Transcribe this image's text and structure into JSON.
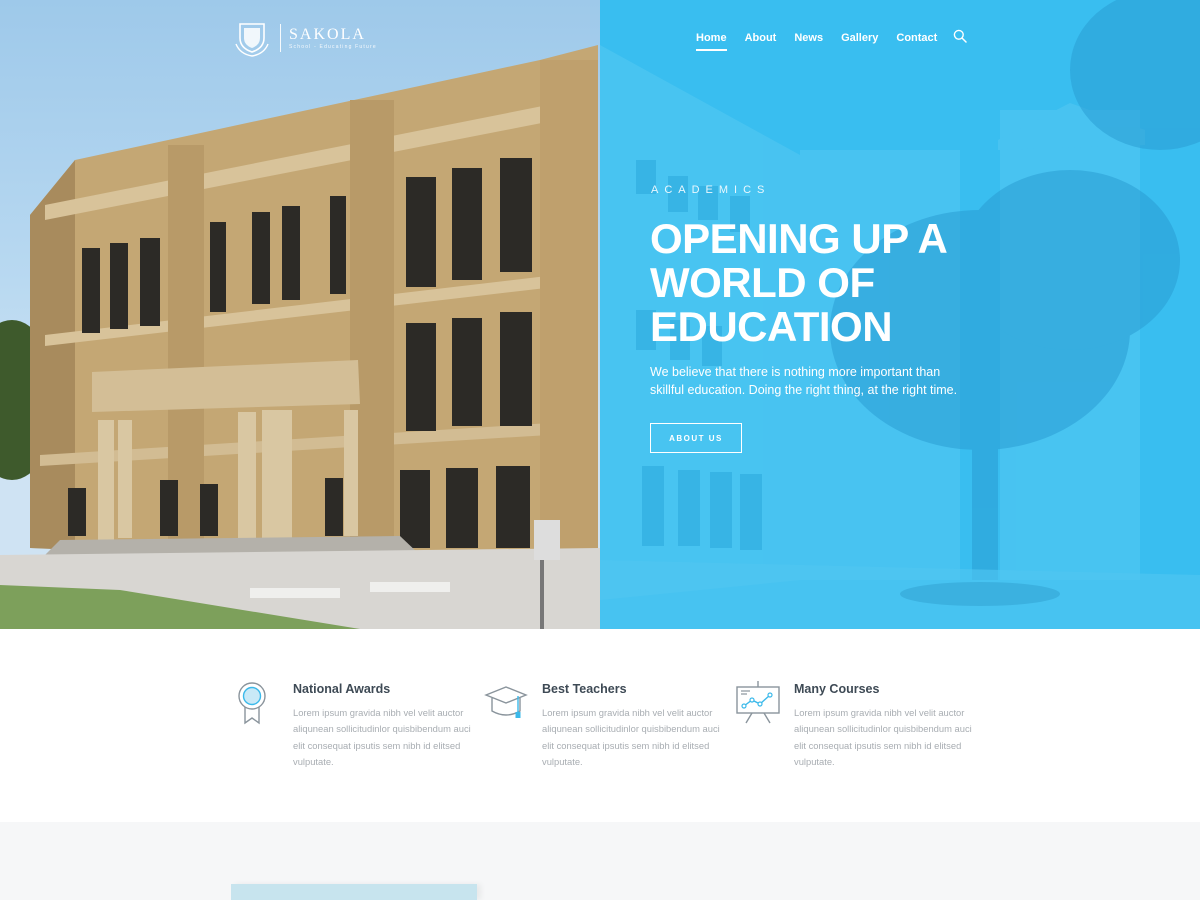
{
  "brand": {
    "name": "SAKOLA",
    "tagline": "School - Educating Future"
  },
  "nav": {
    "items": [
      {
        "label": "Home",
        "active": true
      },
      {
        "label": "About",
        "active": false
      },
      {
        "label": "News",
        "active": false
      },
      {
        "label": "Gallery",
        "active": false
      },
      {
        "label": "Contact",
        "active": false
      }
    ],
    "search_icon": "search-icon"
  },
  "hero": {
    "eyebrow": "ACADEMICS",
    "headline": [
      "OPENING UP A",
      "WORLD OF",
      "EDUCATION"
    ],
    "lead": "We believe that there is nothing more important than skillful education. Doing the right thing, at the right time.",
    "cta_label": "ABOUT US",
    "accent_color": "#39bef0"
  },
  "features": [
    {
      "icon": "award-medal-icon",
      "title": "National Awards",
      "text": "Lorem ipsum gravida nibh vel velit auctor aliqunean sollicitudinlor quisbibendum auci elit consequat ipsutis sem nibh id elitsed vulputate."
    },
    {
      "icon": "graduation-cap-icon",
      "title": "Best Teachers",
      "text": "Lorem ipsum gravida nibh vel velit auctor aliqunean sollicitudinlor quisbibendum auci elit consequat ipsutis sem nibh id elitsed vulputate."
    },
    {
      "icon": "presentation-board-icon",
      "title": "Many Courses",
      "text": "Lorem ipsum gravida nibh vel velit auctor aliqunean sollicitudinlor quisbibendum auci elit consequat ipsutis sem nibh id elitsed vulputate."
    }
  ],
  "colors": {
    "heading": "#3e4a55",
    "body_text": "#a8adb2",
    "icon_line": "#8a949c",
    "icon_accent": "#3bb9ea"
  }
}
